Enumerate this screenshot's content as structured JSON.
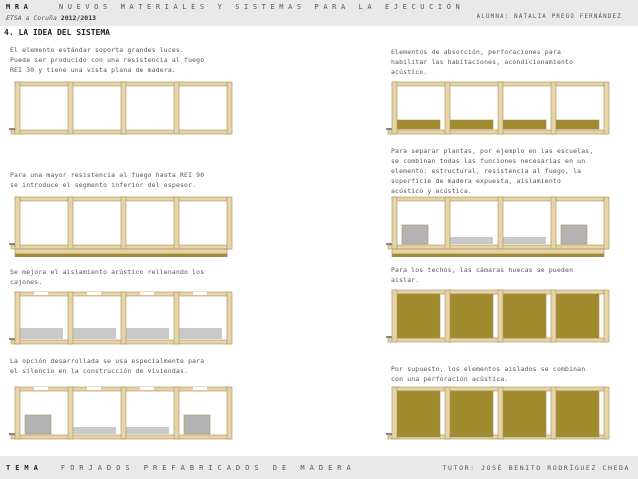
{
  "header": {
    "course_code": "MRA",
    "course_title": "NUEVOS MATERIALES Y SISTEMAS PARA LA EJECUCIÓN",
    "school": "ETSA a Coruña",
    "year": "2012/2013",
    "student": "ALUMNA: NATALIA PREGO FERNÁNDEZ"
  },
  "section_title": "4. LA IDEA DEL SISTEMA",
  "captions": {
    "c1": "El elemento estándar soporta grandes luces.\nPuede ser producido con una resistencia al fuego\nREI 30 y tiene una vista plana de madera.",
    "c2": "Para una mayor resistencia al fuego hasta REI 90\nse introduce el segmento inferior del espesor.",
    "c3": "Se mejora el aislamiento acústico rellenando los\ncajones.",
    "c4": "La opción desarrollada se usa especialmente para\nel silencio en la construcción de viviendas.",
    "c5": "Elementos de absorción, perforaciones para\nhabilitar las habitaciones, acondicionamiento\nacústico.",
    "c6": "Para separar plantas, por ejemplo en las escuelas,\nse combinan todas las funciones necesarias en un\nelemento: estructural, resistencia al fuego, la\nsuperficie de madera expuesta, aislamiento\nacústico y acústica.",
    "c7": "Para los techos, las cámaras huecas se pueden\naislar.",
    "c8": "Por supuesto, los elementos aislados se combinan\ncon una perforación acústica."
  },
  "footer": {
    "tema_label": "TEMA",
    "tema_title": "FORJADOS PREFABRICADOS DE MADERA",
    "tutor": "TUTOR: JOSÉ BENITO RODRÍGUEZ CHEDA"
  },
  "colors": {
    "timber": "#e6d3a6",
    "timber_edge": "#a8925e",
    "insulation": "#a08a2e",
    "gravel": "#c9c9c9",
    "gray_block": "#b3b3b3",
    "background": "#ffffff"
  }
}
